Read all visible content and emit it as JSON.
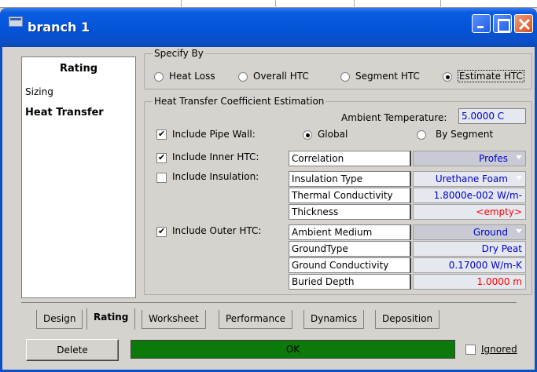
{
  "window": {
    "title": "branch 1"
  },
  "sidebar": {
    "header": "Rating",
    "items": [
      {
        "label": "Sizing",
        "bold": false
      },
      {
        "label": "Heat Transfer",
        "bold": true
      }
    ]
  },
  "specify_by": {
    "legend": "Specify By",
    "options": [
      {
        "label": "Heat Loss",
        "selected": false
      },
      {
        "label": "Overall HTC",
        "selected": false
      },
      {
        "label": "Segment HTC",
        "selected": false
      },
      {
        "label": "Estimate HTC",
        "selected": true
      }
    ]
  },
  "htc_estimation": {
    "legend": "Heat Transfer Coefficient Estimation",
    "ambient_temp_label": "Ambient Temperature:",
    "ambient_temp_value": "5.0000 C",
    "pipe_wall": {
      "label": "Include Pipe Wall:",
      "checked": true,
      "option_global": "Global",
      "option_by_segment": "By Segment",
      "selected": "Global"
    },
    "inner_htc": {
      "label": "Include Inner HTC:",
      "checked": true,
      "rows": [
        {
          "label": "Correlation",
          "value": "Profes"
        }
      ]
    },
    "insulation": {
      "label": "Include Insulation:",
      "checked": false,
      "rows": [
        {
          "label": "Insulation Type",
          "value": "Urethane Foam"
        },
        {
          "label": "Thermal Conductivity",
          "value": "1.8000e-002 W/m-"
        },
        {
          "label": "Thickness",
          "value": "<empty>"
        }
      ]
    },
    "outer_htc": {
      "label": "Include Outer HTC:",
      "checked": true,
      "rows": [
        {
          "label": "Ambient Medium",
          "value": "Ground"
        },
        {
          "label": "GroundType",
          "value": "Dry Peat"
        },
        {
          "label": "Ground Conductivity",
          "value": "0.17000 W/m-K"
        },
        {
          "label": "Buried Depth",
          "value": "1.0000 m"
        }
      ]
    }
  },
  "tabs": [
    "Design",
    "Rating",
    "Worksheet",
    "Performance",
    "Dynamics",
    "Deposition"
  ],
  "active_tab": "Rating",
  "footer": {
    "delete_label": "Delete",
    "status_text": "OK",
    "ignored_label": "Ignored",
    "ignored_checked": false
  },
  "colors": {
    "value_blue": "#0000cc",
    "value_red": "#ff0000",
    "status_green": "#0b7a0b"
  }
}
